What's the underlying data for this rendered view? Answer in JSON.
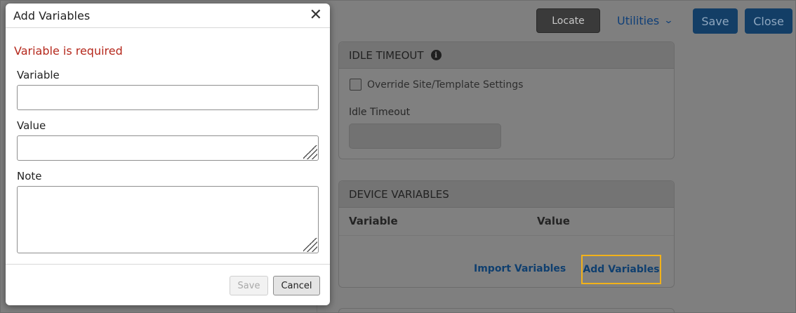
{
  "topbar": {
    "locate_label": "Locate",
    "utilities_label": "Utilities",
    "save_label": "Save",
    "close_label": "Close"
  },
  "idle_timeout": {
    "title": "IDLE TIMEOUT",
    "override_label": "Override Site/Template Settings",
    "override_checked": false,
    "field_label": "Idle Timeout",
    "field_value": ""
  },
  "device_variables": {
    "title": "DEVICE VARIABLES",
    "columns": [
      "Variable",
      "Value"
    ],
    "rows": [],
    "import_label": "Import Variables",
    "add_label": "Add Variables"
  },
  "modal": {
    "title": "Add Variables",
    "close_glyph": "✕",
    "error_message": "Variable is required",
    "fields": {
      "variable": {
        "label": "Variable",
        "value": ""
      },
      "value": {
        "label": "Value",
        "value": ""
      },
      "note": {
        "label": "Note",
        "value": ""
      }
    },
    "save_label": "Save",
    "save_enabled": false,
    "cancel_label": "Cancel"
  },
  "colors": {
    "error": "#b5281c",
    "highlight": "#f2b21a",
    "primary": "#1c5a96"
  }
}
